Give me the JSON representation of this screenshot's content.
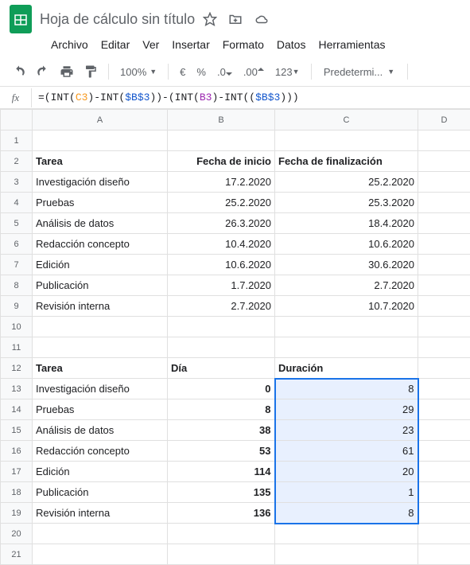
{
  "doc": {
    "title": "Hoja de cálculo sin título"
  },
  "menu": {
    "file": "Archivo",
    "edit": "Editar",
    "view": "Ver",
    "insert": "Insertar",
    "format": "Formato",
    "data": "Datos",
    "tools": "Herramientas"
  },
  "toolbar": {
    "zoom": "100%",
    "currency": "€",
    "percent": "%",
    "dec_dec": ".0",
    "inc_dec": ".00",
    "more_fmt": "123",
    "font": "Predetermi..."
  },
  "formula": {
    "prefix": "=(INT(",
    "c3": "C3",
    "mid1": ")-INT(",
    "b3a": "$B$3",
    "mid2": "))-(INT(",
    "b3": "B3",
    "mid3": ")-INT((",
    "b3b": "$B$3",
    "suffix": ")))"
  },
  "columns": [
    "A",
    "B",
    "C",
    "D"
  ],
  "rows": [
    "1",
    "2",
    "3",
    "4",
    "5",
    "6",
    "7",
    "8",
    "9",
    "10",
    "11",
    "12",
    "13",
    "14",
    "15",
    "16",
    "17",
    "18",
    "19",
    "20",
    "21"
  ],
  "headers1": {
    "a": "Tarea",
    "b": "Fecha de inicio",
    "c": "Fecha de finalización"
  },
  "table1": [
    {
      "a": "Investigación diseño",
      "b": "17.2.2020",
      "c": "25.2.2020"
    },
    {
      "a": "Pruebas",
      "b": "25.2.2020",
      "c": "25.3.2020"
    },
    {
      "a": "Análisis de datos",
      "b": "26.3.2020",
      "c": "18.4.2020"
    },
    {
      "a": "Redacción concepto",
      "b": "10.4.2020",
      "c": "10.6.2020"
    },
    {
      "a": "Edición",
      "b": "10.6.2020",
      "c": "30.6.2020"
    },
    {
      "a": "Publicación",
      "b": "1.7.2020",
      "c": "2.7.2020"
    },
    {
      "a": "Revisión interna",
      "b": "2.7.2020",
      "c": "10.7.2020"
    }
  ],
  "headers2": {
    "a": "Tarea",
    "b": "Día",
    "c": "Duración"
  },
  "table2": [
    {
      "a": "Investigación diseño",
      "b": "0",
      "c": "8"
    },
    {
      "a": "Pruebas",
      "b": "8",
      "c": "29"
    },
    {
      "a": "Análisis de datos",
      "b": "38",
      "c": "23"
    },
    {
      "a": "Redacción concepto",
      "b": "53",
      "c": "61"
    },
    {
      "a": "Edición",
      "b": "114",
      "c": "20"
    },
    {
      "a": "Publicación",
      "b": "135",
      "c": "1"
    },
    {
      "a": "Revisión interna",
      "b": "136",
      "c": "8"
    }
  ]
}
